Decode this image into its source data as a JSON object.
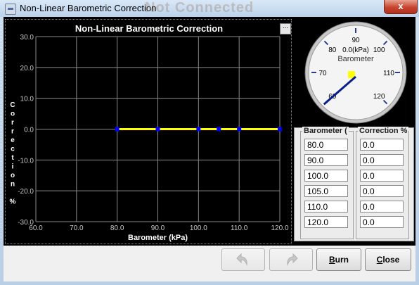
{
  "window": {
    "title": "Non-Linear Barometric Correction",
    "background_title": "Not Connected",
    "close_glyph": "x"
  },
  "chart": {
    "title": "Non-Linear Barometric Correction",
    "menu_glyph": "...",
    "ylabel_letters": [
      "C",
      "o",
      "r",
      "r",
      "e",
      "c",
      "t",
      "i",
      "o",
      "n",
      "",
      "%"
    ]
  },
  "chart_data": {
    "type": "line",
    "title": "Non-Linear Barometric Correction",
    "xlabel": "Barometer (kPa)",
    "ylabel": "Correction %",
    "xlim": [
      60.0,
      120.0
    ],
    "ylim": [
      -30.0,
      30.0
    ],
    "x_ticks": [
      "60.0",
      "70.0",
      "80.0",
      "90.0",
      "100.0",
      "110.0",
      "120.0"
    ],
    "y_ticks": [
      "30.0",
      "20.0",
      "10.0",
      "0.0",
      "-10.0",
      "-20.0",
      "-30.0"
    ],
    "x": [
      80.0,
      90.0,
      100.0,
      105.0,
      110.0,
      120.0
    ],
    "y": [
      0.0,
      0.0,
      0.0,
      0.0,
      0.0,
      0.0
    ],
    "line_color": "#ffff00",
    "point_color": "#0000ff",
    "grid": true,
    "background": "#000000"
  },
  "gauge": {
    "value_text": "0.0(kPa)",
    "label": "Barometer",
    "ticks": [
      "60",
      "70",
      "80",
      "90",
      "100",
      "110",
      "120"
    ],
    "value": 0.0,
    "min": 60,
    "max": 120
  },
  "table": {
    "barometer_header": "Barometer (",
    "correction_header": "Correction %",
    "barometer": [
      "80.0",
      "90.0",
      "100.0",
      "105.0",
      "110.0",
      "120.0"
    ],
    "correction": [
      "0.0",
      "0.0",
      "0.0",
      "0.0",
      "0.0",
      "0.0"
    ]
  },
  "buttons": {
    "undo_icon": "undo-icon",
    "redo_icon": "redo-icon",
    "burn_mnemonic": "B",
    "burn_rest": "urn",
    "close_mnemonic": "C",
    "close_rest": "lose"
  }
}
